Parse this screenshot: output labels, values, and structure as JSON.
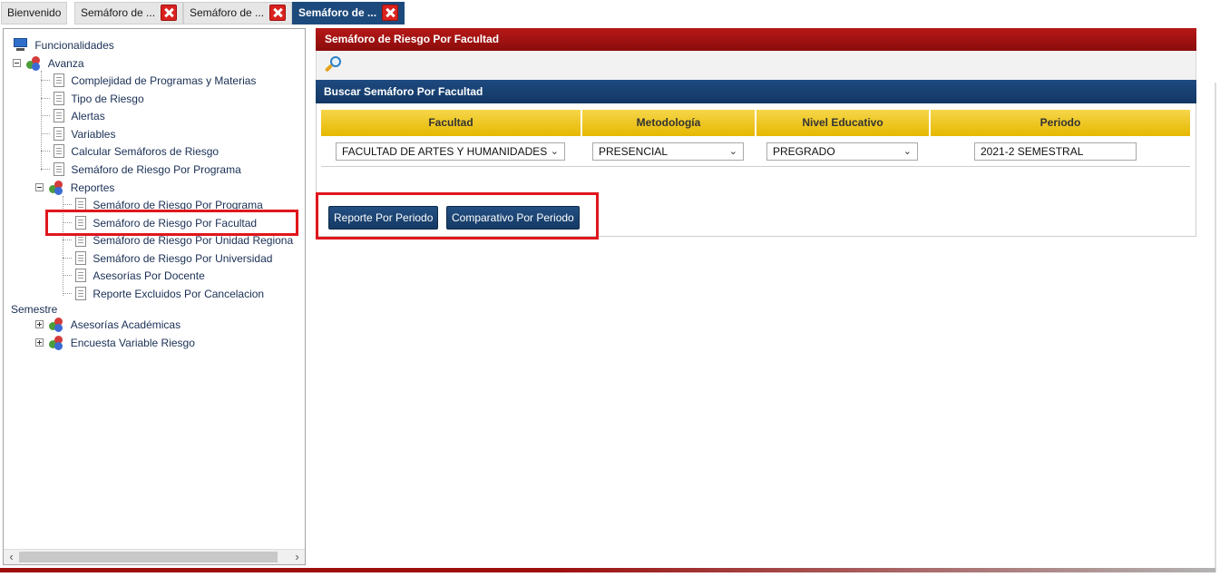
{
  "tabs": [
    {
      "label": "Bienvenido",
      "active": false,
      "closable": false
    },
    {
      "label": "Semáforo de ...",
      "active": false,
      "closable": true
    },
    {
      "label": "Semáforo de ...",
      "active": false,
      "closable": true
    },
    {
      "label": "Semáforo de ...",
      "active": true,
      "closable": true
    }
  ],
  "sidebar": {
    "root_label": "Funcionalidades",
    "avanza": {
      "label": "Avanza",
      "items": [
        "Complejidad de Programas y Materias",
        "Tipo de Riesgo",
        "Alertas",
        "Variables",
        "Calcular Semáforos de Riesgo",
        "Semáforo de Riesgo Por Programa"
      ],
      "reportes": {
        "label": "Reportes",
        "items": [
          "Semáforo de Riesgo Por Programa",
          "Semáforo de Riesgo Por Facultad",
          "Semáforo de Riesgo Por Unidad Regiona",
          "Semáforo de Riesgo Por Universidad",
          "Asesorías Por Docente",
          "Reporte Excluidos Por Cancelacion"
        ]
      }
    },
    "semestre_label": "Semestre",
    "semestre_items": [
      "Asesorías Académicas",
      "Encuesta Variable Riesgo"
    ]
  },
  "main": {
    "panel_title": "Semáforo de Riesgo Por Facultad",
    "search_header": "Buscar Semáforo Por Facultad",
    "columns": [
      "Facultad",
      "Metodología",
      "Nivel Educativo",
      "Periodo"
    ],
    "facultad_value": "FACULTAD DE ARTES Y HUMANIDADES",
    "metodologia_value": "PRESENCIAL",
    "nivel_value": "PREGRADO",
    "periodo_value": "2021-2 SEMESTRAL",
    "buttons": {
      "report": "Reporte Por Periodo",
      "compare": "Comparativo Por Periodo"
    }
  },
  "colors": {
    "title_bar": "#9d0d0d",
    "header_bar": "#1a426f",
    "grid_header": "#e8bd0f",
    "highlight": "#e0161c",
    "active_tab": "#1d4a7c"
  }
}
